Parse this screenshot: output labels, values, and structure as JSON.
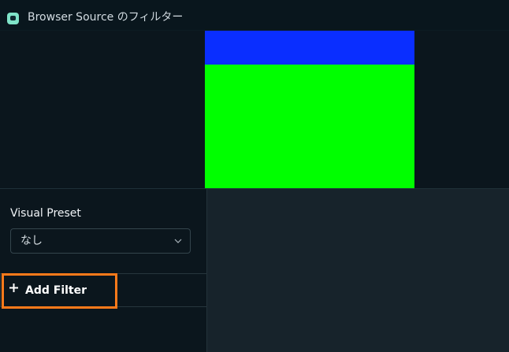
{
  "window": {
    "title": "Browser Source のフィルター"
  },
  "preview": {
    "top_color": "#0a2eff",
    "bottom_color": "#00ff00"
  },
  "left_panel": {
    "visual_preset_label": "Visual Preset",
    "visual_preset_value": "なし",
    "add_filter_label": "Add Filter"
  },
  "icons": {
    "app": "app-icon",
    "dropdown": "chevron-down-icon",
    "add": "plus-icon"
  }
}
